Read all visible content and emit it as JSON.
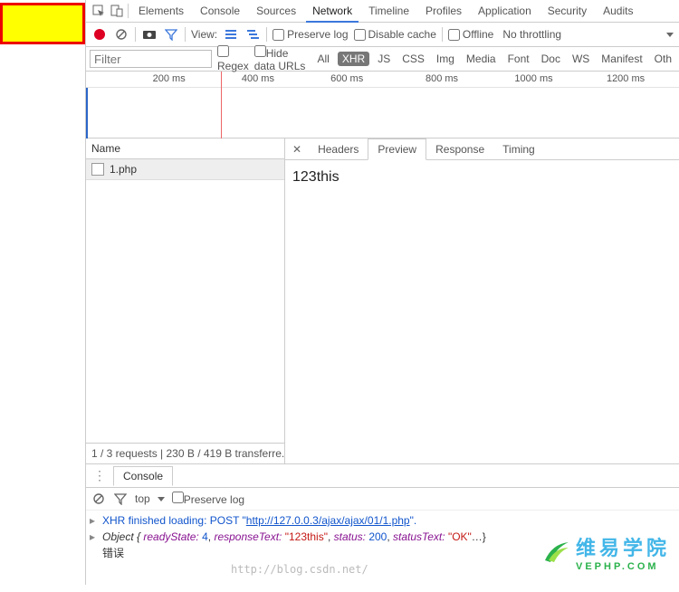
{
  "tabs": {
    "elements": "Elements",
    "console": "Console",
    "sources": "Sources",
    "network": "Network",
    "timeline": "Timeline",
    "profiles": "Profiles",
    "application": "Application",
    "security": "Security",
    "audits": "Audits"
  },
  "toolbar": {
    "view": "View:",
    "preserve": "Preserve log",
    "disable_cache": "Disable cache",
    "offline": "Offline",
    "throttling": "No throttling"
  },
  "filterbar": {
    "placeholder": "Filter",
    "regex": "Regex",
    "hide_urls": "Hide data URLs",
    "chips": {
      "all": "All",
      "xhr": "XHR",
      "js": "JS",
      "css": "CSS",
      "img": "Img",
      "media": "Media",
      "font": "Font",
      "doc": "Doc",
      "ws": "WS",
      "manifest": "Manifest",
      "other": "Oth"
    }
  },
  "timeline": {
    "ticks": [
      "200 ms",
      "400 ms",
      "600 ms",
      "800 ms",
      "1000 ms",
      "1200 ms"
    ]
  },
  "list": {
    "header": "Name",
    "items": [
      "1.php"
    ],
    "status": "1 / 3 requests | 230 B / 419 B transferre..."
  },
  "detail": {
    "tabs": {
      "headers": "Headers",
      "preview": "Preview",
      "response": "Response",
      "timing": "Timing"
    },
    "preview": "123this"
  },
  "console": {
    "tab": "Console",
    "context": "top",
    "preserve": "Preserve log",
    "line1_prefix": "XHR finished loading: POST \"",
    "line1_url": "http://127.0.0.3/ajax/ajax/01/1.php",
    "line1_suffix": "\".",
    "line2_label": "Object ",
    "line2_open": "{",
    "rs_key": "readyState: ",
    "rs_val": "4",
    "rt_key": "responseText: ",
    "rt_val": "\"123this\"",
    "st_key": "status: ",
    "st_val": "200",
    "sx_key": "statusText: ",
    "sx_val": "\"OK\"",
    "line3": "错误"
  },
  "watermark": "http://blog.csdn.net/",
  "brand": {
    "han": "维易学院",
    "sub": "VEPHP.COM"
  }
}
